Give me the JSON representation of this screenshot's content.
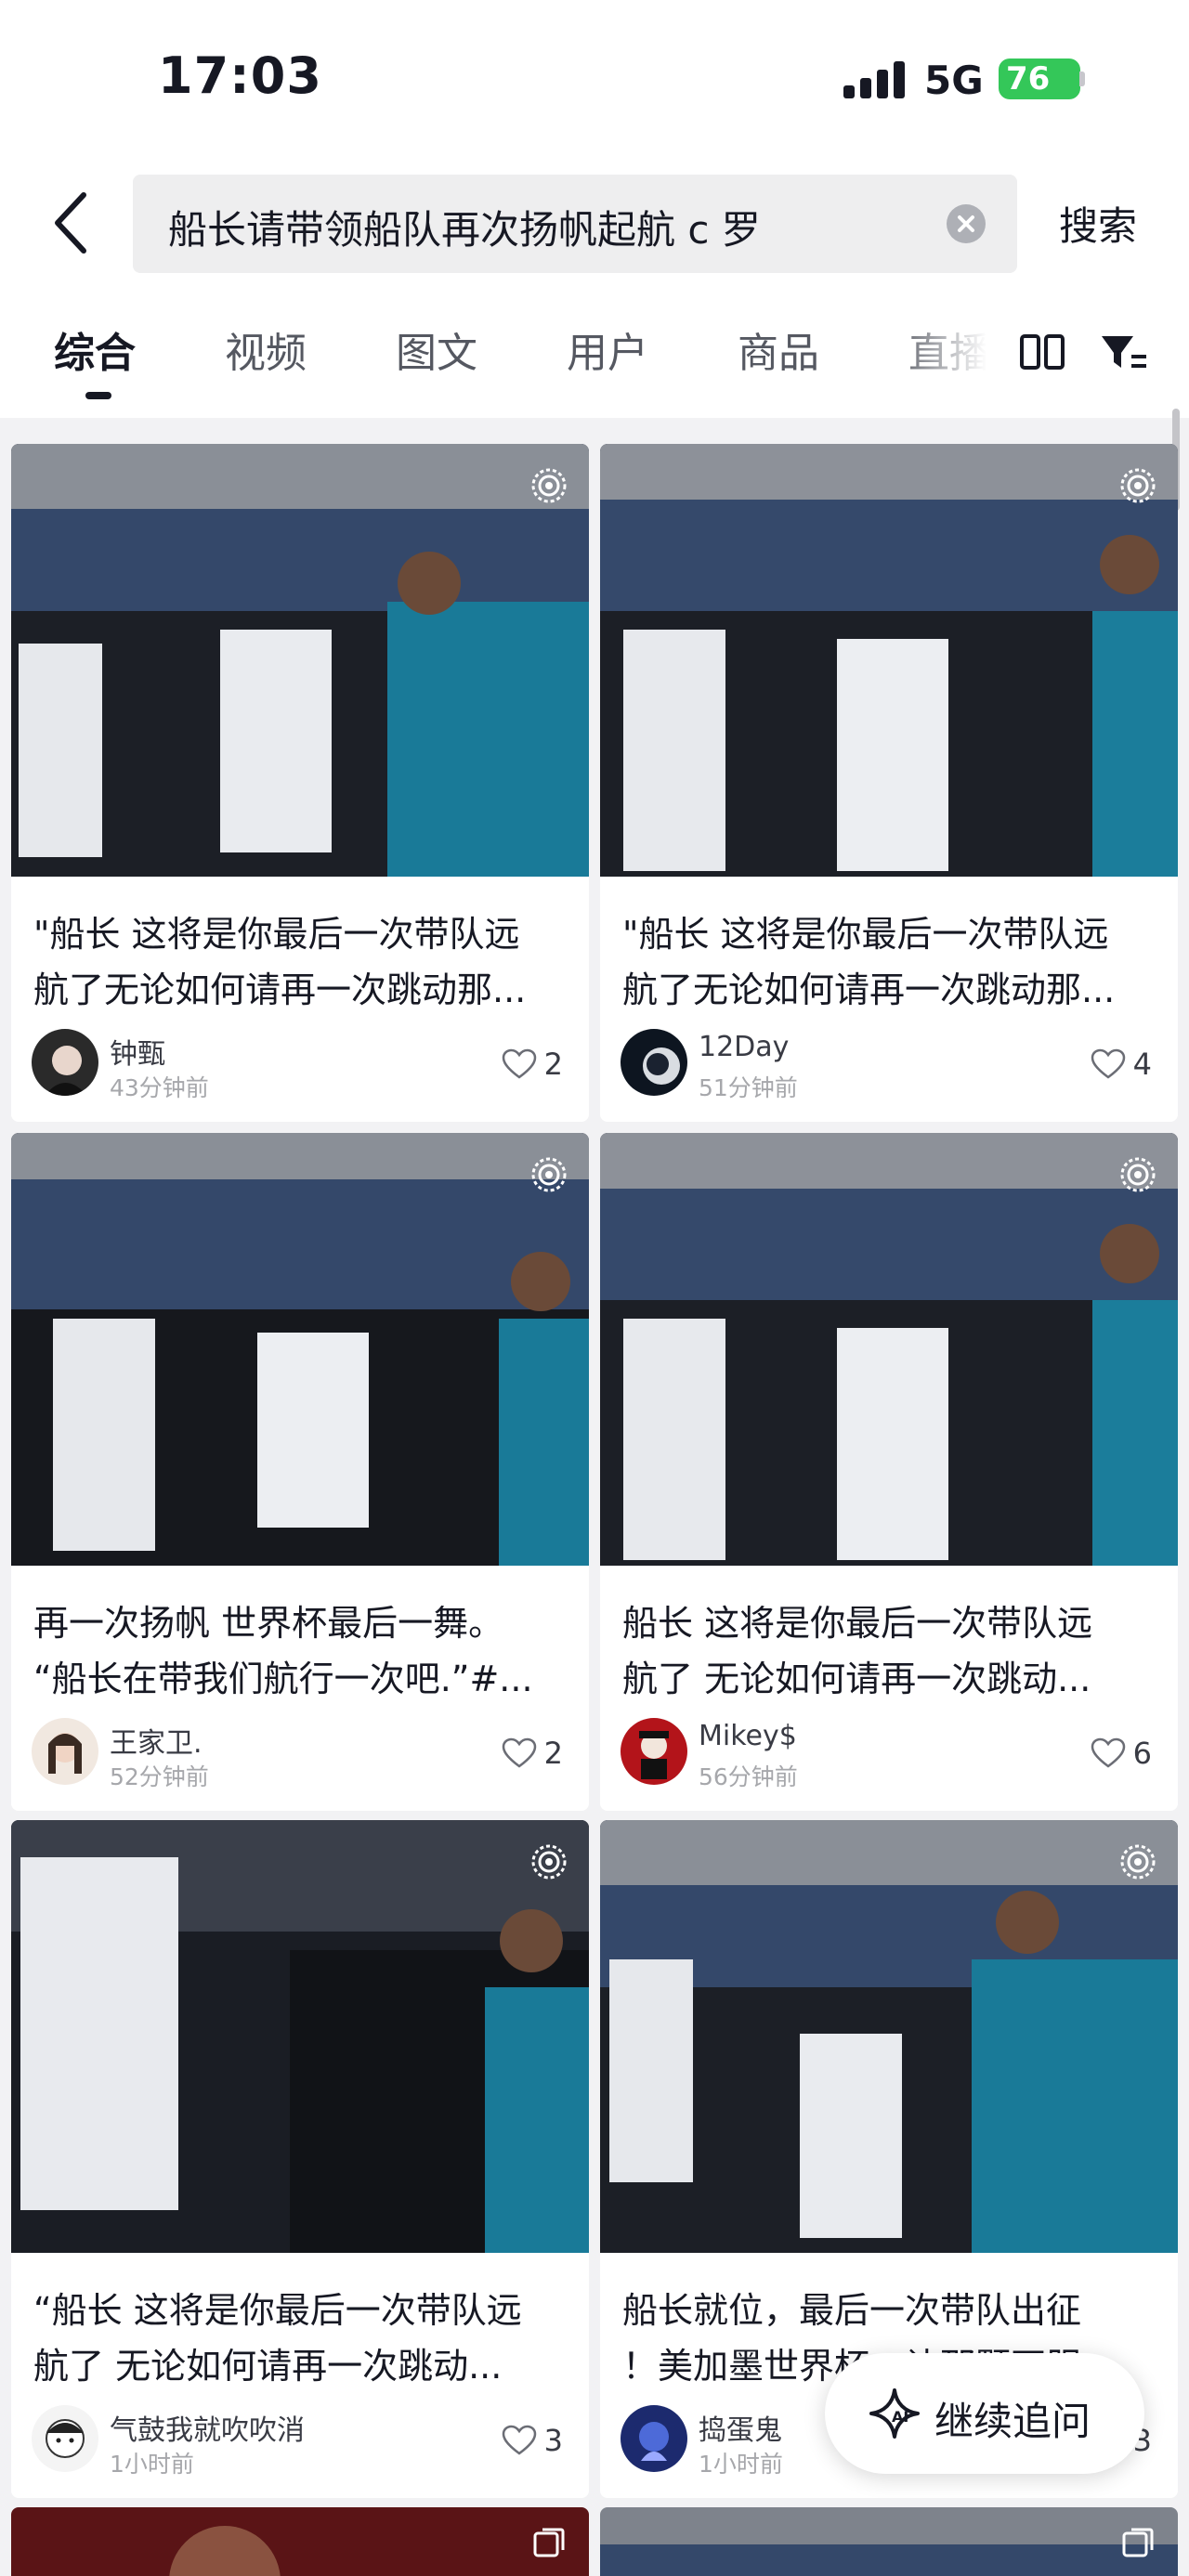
{
  "status_bar": {
    "time": "17:03",
    "network": "5G",
    "battery": "76"
  },
  "search": {
    "query": "船长请带领船队再次扬帆起航 c 罗",
    "submit_label": "搜索"
  },
  "tabs": [
    {
      "label": "综合",
      "active": true
    },
    {
      "label": "视频"
    },
    {
      "label": "图文"
    },
    {
      "label": "用户"
    },
    {
      "label": "商品"
    },
    {
      "label": "直播"
    }
  ],
  "icons": {
    "back": "back-arrow-icon",
    "clear": "clear-icon",
    "layout": "double-column-icon",
    "filter": "filter-icon",
    "live": "live-photo-icon",
    "gallery": "gallery-icon",
    "like": "heart-icon",
    "follow": "ai-sparkle-icon"
  },
  "colors": {
    "battery": "#34c759",
    "background": "#f2f2f4",
    "text": "#161823",
    "muted": "#a6a7ab"
  },
  "results": [
    {
      "title_line1": "\"船长 这将是你最后一次带队远",
      "title_line2": "航了无论如何请再一次跳动那...",
      "author": "钟甄",
      "time": "43分钟前",
      "likes": "2"
    },
    {
      "title_line1": "\"船长 这将是你最后一次带队远",
      "title_line2": "航了无论如何请再一次跳动那...",
      "author": "12Day",
      "time": "51分钟前",
      "likes": "4"
    },
    {
      "title_line1": "再一次扬帆  世界杯最后一舞。",
      "title_line2": "“船长在带我们航行一次吧.”#...",
      "author": "王家卫.",
      "time": "52分钟前",
      "likes": "2"
    },
    {
      "title_line1": "船长 这将是你最后一次带队远",
      "title_line2": "航了 无论如何请再一次跳动...",
      "author": "Mikey$",
      "time": "56分钟前",
      "likes": "6"
    },
    {
      "title_line1": "“船长 这将是你最后一次带队远",
      "title_line2": "航了 无论如何请再一次跳动...",
      "author": "气鼓我就吹吹消",
      "time": "1小时前",
      "likes": "3"
    },
    {
      "title_line1": "船长就位，最后一次带队出征",
      "title_line2": "！美加墨世界杯，让那颗不服...",
      "author": "捣蛋鬼",
      "time": "1小时前",
      "likes": "3"
    }
  ],
  "follow_button": {
    "label": "继续追问"
  }
}
